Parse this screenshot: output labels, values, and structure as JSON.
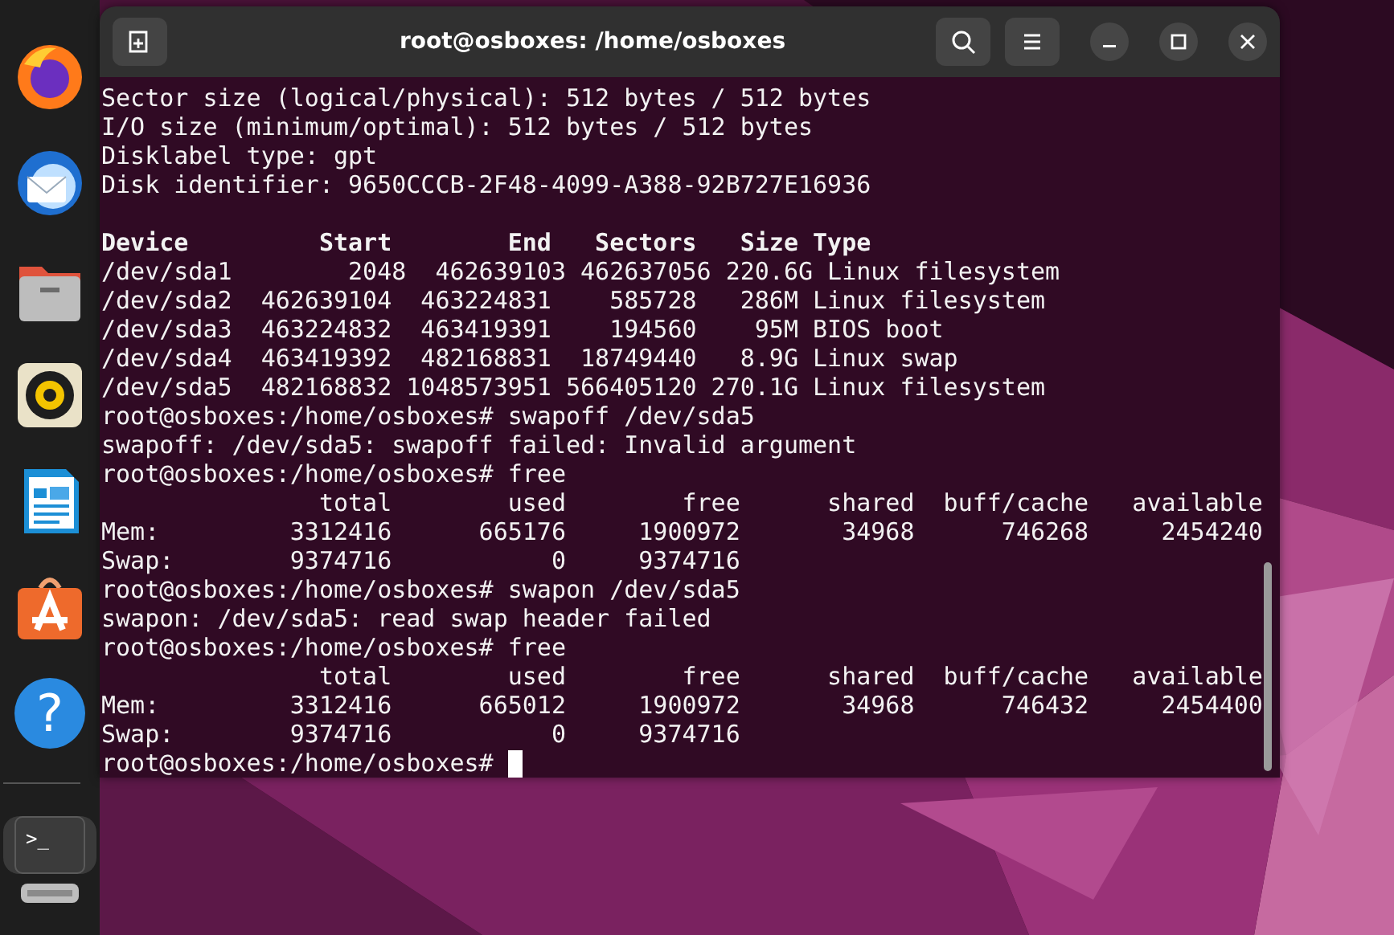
{
  "window": {
    "title": "root@osboxes: /home/osboxes"
  },
  "dock": {
    "items": [
      {
        "kind": "browser",
        "selected": false
      },
      {
        "kind": "mail",
        "selected": false
      },
      {
        "kind": "folder",
        "selected": false
      },
      {
        "kind": "speaker",
        "selected": false
      },
      {
        "kind": "document",
        "selected": false
      },
      {
        "kind": "store",
        "selected": false
      },
      {
        "kind": "help",
        "selected": false,
        "glyph": "?"
      },
      {
        "kind": "terminal",
        "selected": true,
        "glyph": ">_"
      },
      {
        "kind": "drive",
        "selected": false
      }
    ]
  },
  "terminal": {
    "cursor": true,
    "lines": [
      {
        "kind": "output",
        "text": "Sector size (logical/physical): 512 bytes / 512 bytes"
      },
      {
        "kind": "output",
        "text": "I/O size (minimum/optimal): 512 bytes / 512 bytes"
      },
      {
        "kind": "output",
        "text": "Disklabel type: gpt"
      },
      {
        "kind": "output",
        "text": "Disk identifier: 9650CCCB-2F48-4099-A388-92B727E16936"
      },
      {
        "kind": "blank"
      },
      {
        "kind": "header",
        "text": "Device         Start        End   Sectors   Size Type"
      },
      {
        "kind": "output",
        "text": "/dev/sda1        2048  462639103 462637056 220.6G Linux filesystem"
      },
      {
        "kind": "output",
        "text": "/dev/sda2  462639104  463224831    585728   286M Linux filesystem"
      },
      {
        "kind": "output",
        "text": "/dev/sda3  463224832  463419391    194560    95M BIOS boot"
      },
      {
        "kind": "output",
        "text": "/dev/sda4  463419392  482168831  18749440   8.9G Linux swap"
      },
      {
        "kind": "output",
        "text": "/dev/sda5  482168832 1048573951 566405120 270.1G Linux filesystem"
      },
      {
        "kind": "output",
        "text": "root@osboxes:/home/osboxes# swapoff /dev/sda5"
      },
      {
        "kind": "output",
        "text": "swapoff: /dev/sda5: swapoff failed: Invalid argument"
      },
      {
        "kind": "output",
        "text": "root@osboxes:/home/osboxes# free"
      },
      {
        "kind": "output",
        "text": "               total        used        free      shared  buff/cache   available"
      },
      {
        "kind": "output",
        "text": "Mem:         3312416      665176     1900972       34968      746268     2454240"
      },
      {
        "kind": "output",
        "text": "Swap:        9374716           0     9374716"
      },
      {
        "kind": "output",
        "text": "root@osboxes:/home/osboxes# swapon /dev/sda5"
      },
      {
        "kind": "output",
        "text": "swapon: /dev/sda5: read swap header failed"
      },
      {
        "kind": "output",
        "text": "root@osboxes:/home/osboxes# free"
      },
      {
        "kind": "output",
        "text": "               total        used        free      shared  buff/cache   available"
      },
      {
        "kind": "output",
        "text": "Mem:         3312416      665012     1900972       34968      746432     2454400"
      },
      {
        "kind": "output",
        "text": "Swap:        9374716           0     9374716"
      },
      {
        "kind": "output",
        "text": "root@osboxes:/home/osboxes# "
      }
    ]
  }
}
